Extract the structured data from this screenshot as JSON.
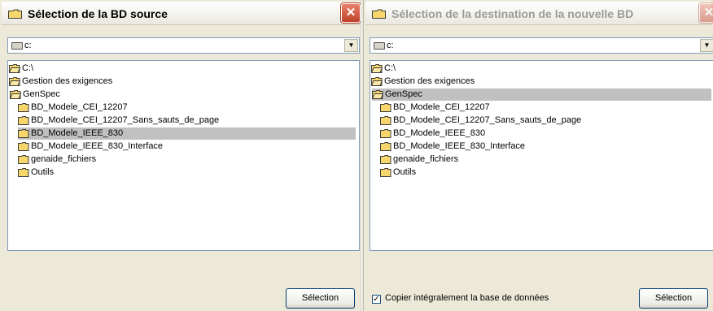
{
  "left_window": {
    "title": "Sélection de la BD source",
    "close": "✕",
    "drive": "c:",
    "tree": [
      {
        "label": "C:\\",
        "type": "open"
      },
      {
        "label": "Gestion des exigences",
        "type": "open"
      },
      {
        "label": "GenSpec",
        "type": "open"
      },
      {
        "label": "BD_Modele_CEI_12207",
        "type": "closed"
      },
      {
        "label": "BD_Modele_CEI_12207_Sans_sauts_de_page",
        "type": "closed"
      },
      {
        "label": "BD_Modele_IEEE_830",
        "type": "closed",
        "selected": true
      },
      {
        "label": "BD_Modele_IEEE_830_Interface",
        "type": "closed"
      },
      {
        "label": "genaide_fichiers",
        "type": "closed"
      },
      {
        "label": "Outils",
        "type": "closed"
      }
    ],
    "button": "Sélection"
  },
  "right_window": {
    "title": "Sélection de la destination de la nouvelle BD",
    "close": "✕",
    "drive": "c:",
    "tree": [
      {
        "label": "C:\\",
        "type": "open"
      },
      {
        "label": "Gestion des exigences",
        "type": "open"
      },
      {
        "label": "GenSpec",
        "type": "open",
        "selected": true
      },
      {
        "label": "BD_Modele_CEI_12207",
        "type": "closed"
      },
      {
        "label": "BD_Modele_CEI_12207_Sans_sauts_de_page",
        "type": "closed"
      },
      {
        "label": "BD_Modele_IEEE_830",
        "type": "closed"
      },
      {
        "label": "BD_Modele_IEEE_830_Interface",
        "type": "closed"
      },
      {
        "label": "genaide_fichiers",
        "type": "closed"
      },
      {
        "label": "Outils",
        "type": "closed"
      }
    ],
    "checkbox_label": "Copier intégralement la base de données",
    "checkbox_checked": true,
    "button": "Sélection"
  },
  "icons": {
    "folder": "folder-icon",
    "open_folder": "open-folder-icon",
    "drive": "drive-icon",
    "dropdown": "chevron-down-icon",
    "close": "close-icon"
  },
  "colors": {
    "folder_fill": "#f7d66c",
    "folder_stroke": "#8a6a00",
    "selection_bg": "#c0c0c0",
    "close_button": "#d9573c"
  }
}
